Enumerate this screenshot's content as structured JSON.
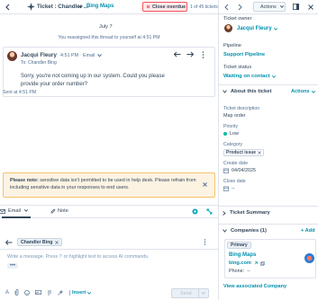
{
  "header": {
    "title": "Ticket : Chandler ...",
    "chip_label": "Bing Maps",
    "close_overdue": "Close overdue",
    "pager": "1 of 45 tickets"
  },
  "thread": {
    "date": "July 7",
    "reassigned": "You reassigned this thread to yourself at 4:51 PM",
    "message": {
      "sender": "Jacqui Fleury",
      "time": "4:51 PM",
      "channel": "Email",
      "to": "To: Chandler Bing",
      "body": "Sorry, you're not coming up in our system. Could you please provide your order number?"
    },
    "sent": "Sent at 4:51 PM"
  },
  "note_banner": {
    "strong": "Please note:",
    "text": " sensitive data isn't permitted to be used in help desk. Please refrain from including sensitive data in your responses to end users."
  },
  "composer": {
    "tab_email": "Email",
    "tab_note": "Note",
    "to_chip": "Chandler Bing",
    "placeholder": "Write a message. Press '/' or highlight text to access AI commands.",
    "ellipsis": "•••",
    "insert": "Insert",
    "send": "Send"
  },
  "sidebar": {
    "actions": "Actions",
    "ticket_owner_label": "Ticket owner",
    "ticket_owner": "Jacqui Fleury",
    "pipeline_label": "Pipeline",
    "pipeline": "Support Pipeline",
    "status_label": "Ticket status",
    "status": "Waiting on contact",
    "about_title": "About this ticket",
    "about_actions": "Actions",
    "desc_label": "Ticket description",
    "desc_value": "Map order",
    "priority_label": "Priority",
    "priority_value": "Low",
    "category_label": "Category",
    "category_value": "Product issue",
    "create_label": "Create date",
    "create_value": "04/04/2025",
    "close_label": "Close date",
    "close_value": "--",
    "summary_title": "Ticket Summary",
    "companies_title": "Companies (1)",
    "add": "+ Add",
    "primary": "Primary",
    "company_name": "Bing Maps",
    "company_domain": "bing.com",
    "phone_label": "Phone:",
    "phone_value": "--",
    "view_company": "View associated Company"
  },
  "colors": {
    "accent": "#0091ae",
    "danger": "#f2545b",
    "warning_bg": "#fdf3e3",
    "text": "#33475b"
  }
}
